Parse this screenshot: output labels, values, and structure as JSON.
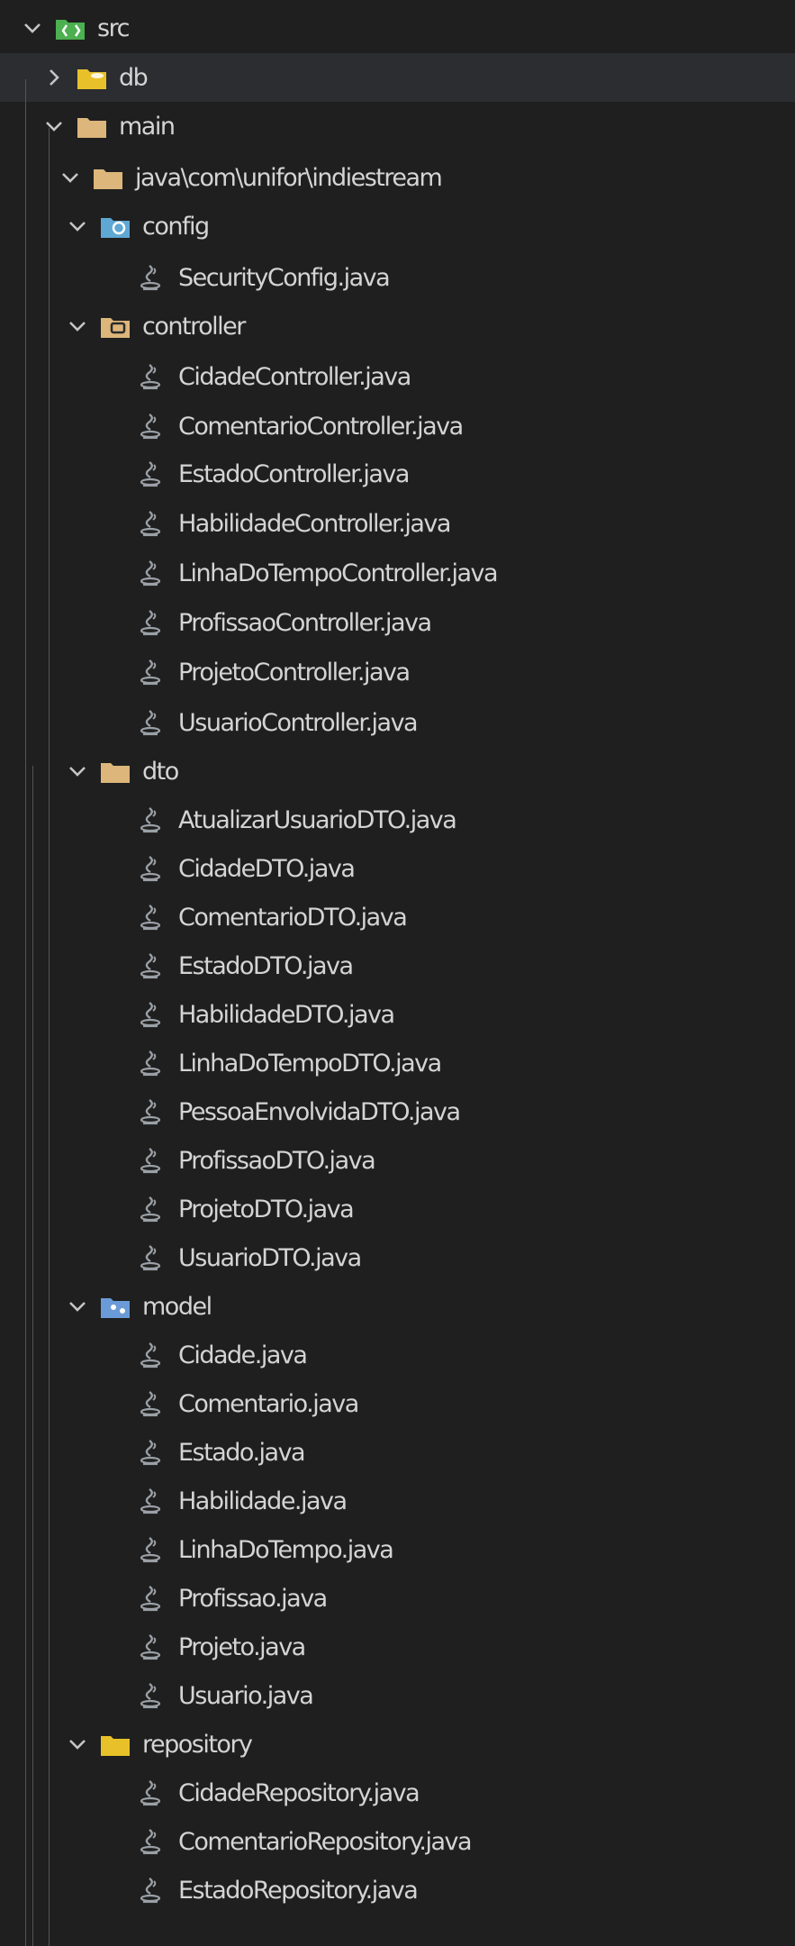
{
  "explorer": {
    "tree": [
      {
        "label": "src",
        "type": "folder",
        "expanded": true,
        "depth": 0,
        "icon": "src-folder-icon"
      },
      {
        "label": "db",
        "type": "folder",
        "expanded": false,
        "depth": 1,
        "icon": "db-folder-icon",
        "selected": true
      },
      {
        "label": "main",
        "type": "folder",
        "expanded": true,
        "depth": 1,
        "icon": "folder-icon"
      },
      {
        "label": "java\\com\\unifor\\indiestream",
        "type": "folder",
        "expanded": true,
        "depth": 2,
        "icon": "folder-icon"
      },
      {
        "label": "config",
        "type": "folder",
        "expanded": true,
        "depth": 3,
        "icon": "config-folder-icon"
      },
      {
        "label": "SecurityConfig.java",
        "type": "file",
        "depth": 4,
        "icon": "java-file-icon"
      },
      {
        "label": "controller",
        "type": "folder",
        "expanded": true,
        "depth": 3,
        "icon": "controller-folder-icon"
      },
      {
        "label": "CidadeController.java",
        "type": "file",
        "depth": 4,
        "icon": "java-file-icon"
      },
      {
        "label": "ComentarioController.java",
        "type": "file",
        "depth": 4,
        "icon": "java-file-icon"
      },
      {
        "label": "EstadoController.java",
        "type": "file",
        "depth": 4,
        "icon": "java-file-icon"
      },
      {
        "label": "HabilidadeController.java",
        "type": "file",
        "depth": 4,
        "icon": "java-file-icon"
      },
      {
        "label": "LinhaDoTempoController.java",
        "type": "file",
        "depth": 4,
        "icon": "java-file-icon"
      },
      {
        "label": "ProfissaoController.java",
        "type": "file",
        "depth": 4,
        "icon": "java-file-icon"
      },
      {
        "label": "ProjetoController.java",
        "type": "file",
        "depth": 4,
        "icon": "java-file-icon"
      },
      {
        "label": "UsuarioController.java",
        "type": "file",
        "depth": 4,
        "icon": "java-file-icon"
      },
      {
        "label": "dto",
        "type": "folder",
        "expanded": true,
        "depth": 3,
        "icon": "folder-icon"
      },
      {
        "label": "AtualizarUsuarioDTO.java",
        "type": "file",
        "depth": 4,
        "icon": "java-file-icon"
      },
      {
        "label": "CidadeDTO.java",
        "type": "file",
        "depth": 4,
        "icon": "java-file-icon"
      },
      {
        "label": "ComentarioDTO.java",
        "type": "file",
        "depth": 4,
        "icon": "java-file-icon"
      },
      {
        "label": "EstadoDTO.java",
        "type": "file",
        "depth": 4,
        "icon": "java-file-icon"
      },
      {
        "label": "HabilidadeDTO.java",
        "type": "file",
        "depth": 4,
        "icon": "java-file-icon"
      },
      {
        "label": "LinhaDoTempoDTO.java",
        "type": "file",
        "depth": 4,
        "icon": "java-file-icon"
      },
      {
        "label": "PessoaEnvolvidaDTO.java",
        "type": "file",
        "depth": 4,
        "icon": "java-file-icon"
      },
      {
        "label": "ProfissaoDTO.java",
        "type": "file",
        "depth": 4,
        "icon": "java-file-icon"
      },
      {
        "label": "ProjetoDTO.java",
        "type": "file",
        "depth": 4,
        "icon": "java-file-icon"
      },
      {
        "label": "UsuarioDTO.java",
        "type": "file",
        "depth": 4,
        "icon": "java-file-icon"
      },
      {
        "label": "model",
        "type": "folder",
        "expanded": true,
        "depth": 3,
        "icon": "model-folder-icon"
      },
      {
        "label": "Cidade.java",
        "type": "file",
        "depth": 4,
        "icon": "java-file-icon"
      },
      {
        "label": "Comentario.java",
        "type": "file",
        "depth": 4,
        "icon": "java-file-icon"
      },
      {
        "label": "Estado.java",
        "type": "file",
        "depth": 4,
        "icon": "java-file-icon"
      },
      {
        "label": "Habilidade.java",
        "type": "file",
        "depth": 4,
        "icon": "java-file-icon"
      },
      {
        "label": "LinhaDoTempo.java",
        "type": "file",
        "depth": 4,
        "icon": "java-file-icon"
      },
      {
        "label": "Profissao.java",
        "type": "file",
        "depth": 4,
        "icon": "java-file-icon"
      },
      {
        "label": "Projeto.java",
        "type": "file",
        "depth": 4,
        "icon": "java-file-icon"
      },
      {
        "label": "Usuario.java",
        "type": "file",
        "depth": 4,
        "icon": "java-file-icon"
      },
      {
        "label": "repository",
        "type": "folder",
        "expanded": true,
        "depth": 3,
        "icon": "repository-folder-icon"
      },
      {
        "label": "CidadeRepository.java",
        "type": "file",
        "depth": 4,
        "icon": "java-file-icon"
      },
      {
        "label": "ComentarioRepository.java",
        "type": "file",
        "depth": 4,
        "icon": "java-file-icon"
      },
      {
        "label": "EstadoRepository.java",
        "type": "file",
        "depth": 4,
        "icon": "java-file-icon"
      }
    ]
  },
  "colors": {
    "background": "#1f1f1f",
    "selected_row": "#2b2d30",
    "text": "#d4d4d4",
    "chevron": "#c5c5c5",
    "folder": "#dcb67a",
    "src_folder": "#4caf50",
    "config_folder": "#5fa8d3",
    "model_folder": "#6a9bd8",
    "repository_folder": "#e8c12a",
    "java_icon": "#9aa0a6"
  }
}
